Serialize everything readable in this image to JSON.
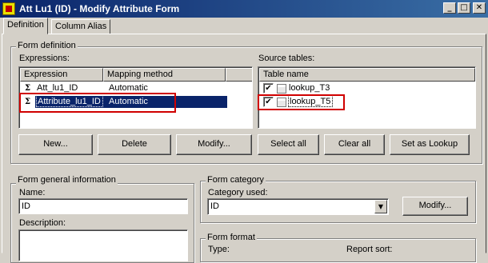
{
  "window": {
    "title": "Att Lu1 (ID) - Modify Attribute Form",
    "minimize_glyph": "_",
    "maximize_glyph": "□",
    "close_glyph": "✕"
  },
  "tabs": [
    {
      "label": "Definition",
      "active": true
    },
    {
      "label": "Column Alias",
      "active": false
    }
  ],
  "form_definition": {
    "legend": "Form definition",
    "expressions_label": "Expressions:",
    "source_tables_label": "Source tables:",
    "expression_columns": [
      "Expression",
      "Mapping method"
    ],
    "expressions": [
      {
        "expression": "Att_lu1_ID",
        "mapping": "Automatic",
        "selected": false
      },
      {
        "expression": "Attribute_lu1_ID",
        "mapping": "Automatic",
        "selected": true
      }
    ],
    "source_table_column": "Table name",
    "source_tables": [
      {
        "name": "lookup_T3",
        "checked": true
      },
      {
        "name": "lookup_T5",
        "checked": true
      }
    ],
    "buttons": {
      "new": "New...",
      "delete": "Delete",
      "modify": "Modify...",
      "select_all": "Select all",
      "clear_all": "Clear all",
      "set_as_lookup": "Set as Lookup"
    }
  },
  "form_general": {
    "legend": "Form general information",
    "name_label": "Name:",
    "name_value": "ID",
    "description_label": "Description:",
    "description_value": ""
  },
  "form_category": {
    "legend": "Form category",
    "category_label": "Category used:",
    "category_value": "ID",
    "modify_button": "Modify..."
  },
  "form_format": {
    "legend": "Form format",
    "type_label": "Type:",
    "report_sort_label": "Report sort:"
  },
  "icons": {
    "app": "attribute-icon",
    "expression": "expression-icon",
    "table": "table-icon",
    "checkbox_check": "✔",
    "dropdown": "▼"
  },
  "colors": {
    "title_bar": "#0a246a",
    "selection": "#0a246a",
    "highlight_box": "#d00000",
    "face": "#d4d0c8"
  }
}
